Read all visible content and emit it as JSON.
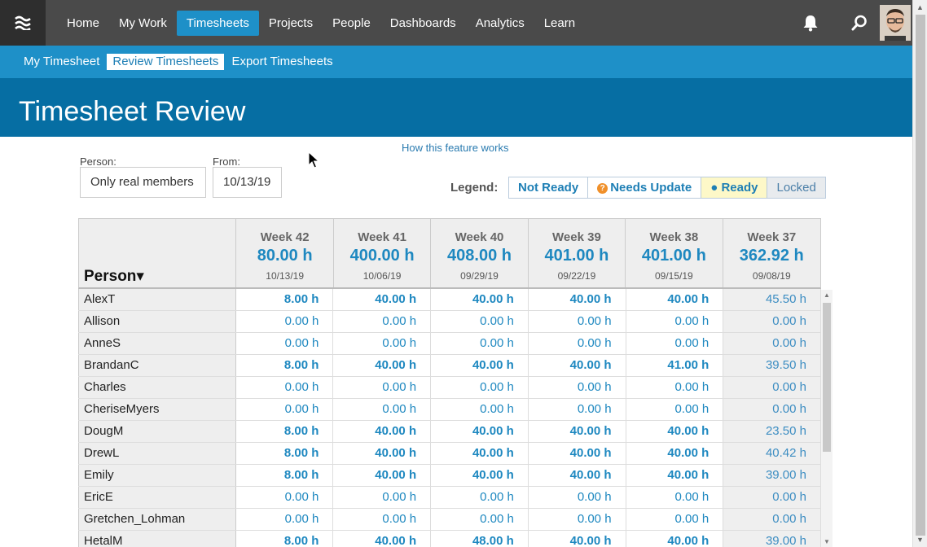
{
  "nav": {
    "logo_icon": "menu-waves-icon",
    "items": [
      {
        "label": "Home"
      },
      {
        "label": "My Work"
      },
      {
        "label": "Timesheets",
        "active": true
      },
      {
        "label": "Projects"
      },
      {
        "label": "People"
      },
      {
        "label": "Dashboards"
      },
      {
        "label": "Analytics"
      },
      {
        "label": "Learn"
      }
    ],
    "bell_icon": "bell-icon",
    "search_icon": "search-icon"
  },
  "subnav": {
    "items": [
      {
        "label": "My Timesheet"
      },
      {
        "label": "Review Timesheets",
        "active": true
      },
      {
        "label": "Export Timesheets"
      }
    ]
  },
  "page": {
    "title": "Timesheet Review",
    "help_link": "How this feature works"
  },
  "filters": {
    "person_label": "Person:",
    "person_value": "Only real members",
    "from_label": "From:",
    "from_value": "10/13/19"
  },
  "legend": {
    "label": "Legend:",
    "not_ready": "Not Ready",
    "needs_update": "Needs Update",
    "ready": "Ready",
    "locked": "Locked"
  },
  "table": {
    "person_header": "Person▾",
    "weeks": [
      {
        "name": "Week 42",
        "total": "80.00 h",
        "date": "10/13/19"
      },
      {
        "name": "Week 41",
        "total": "400.00 h",
        "date": "10/06/19"
      },
      {
        "name": "Week 40",
        "total": "408.00 h",
        "date": "09/29/19"
      },
      {
        "name": "Week 39",
        "total": "401.00 h",
        "date": "09/22/19"
      },
      {
        "name": "Week 38",
        "total": "401.00 h",
        "date": "09/15/19"
      },
      {
        "name": "Week 37",
        "total": "362.92 h",
        "date": "09/08/19"
      }
    ],
    "rows": [
      {
        "person": "AlexT",
        "values": [
          "8.00 h",
          "40.00 h",
          "40.00 h",
          "40.00 h",
          "40.00 h",
          "45.50 h"
        ],
        "bold": true
      },
      {
        "person": "Allison",
        "values": [
          "0.00 h",
          "0.00 h",
          "0.00 h",
          "0.00 h",
          "0.00 h",
          "0.00 h"
        ],
        "bold": false
      },
      {
        "person": "AnneS",
        "values": [
          "0.00 h",
          "0.00 h",
          "0.00 h",
          "0.00 h",
          "0.00 h",
          "0.00 h"
        ],
        "bold": false
      },
      {
        "person": "BrandanC",
        "values": [
          "8.00 h",
          "40.00 h",
          "40.00 h",
          "40.00 h",
          "41.00 h",
          "39.50 h"
        ],
        "bold": true
      },
      {
        "person": "Charles",
        "values": [
          "0.00 h",
          "0.00 h",
          "0.00 h",
          "0.00 h",
          "0.00 h",
          "0.00 h"
        ],
        "bold": false
      },
      {
        "person": "CheriseMyers",
        "values": [
          "0.00 h",
          "0.00 h",
          "0.00 h",
          "0.00 h",
          "0.00 h",
          "0.00 h"
        ],
        "bold": false
      },
      {
        "person": "DougM",
        "values": [
          "8.00 h",
          "40.00 h",
          "40.00 h",
          "40.00 h",
          "40.00 h",
          "23.50 h"
        ],
        "bold": true
      },
      {
        "person": "DrewL",
        "values": [
          "8.00 h",
          "40.00 h",
          "40.00 h",
          "40.00 h",
          "40.00 h",
          "40.42 h"
        ],
        "bold": true
      },
      {
        "person": "Emily",
        "values": [
          "8.00 h",
          "40.00 h",
          "40.00 h",
          "40.00 h",
          "40.00 h",
          "39.00 h"
        ],
        "bold": true
      },
      {
        "person": "EricE",
        "values": [
          "0.00 h",
          "0.00 h",
          "0.00 h",
          "0.00 h",
          "0.00 h",
          "0.00 h"
        ],
        "bold": false
      },
      {
        "person": "Gretchen_Lohman",
        "values": [
          "0.00 h",
          "0.00 h",
          "0.00 h",
          "0.00 h",
          "0.00 h",
          "0.00 h"
        ],
        "bold": false
      },
      {
        "person": "HetalM",
        "values": [
          "8.00 h",
          "40.00 h",
          "48.00 h",
          "40.00 h",
          "40.00 h",
          "39.00 h"
        ],
        "bold": true
      }
    ]
  }
}
